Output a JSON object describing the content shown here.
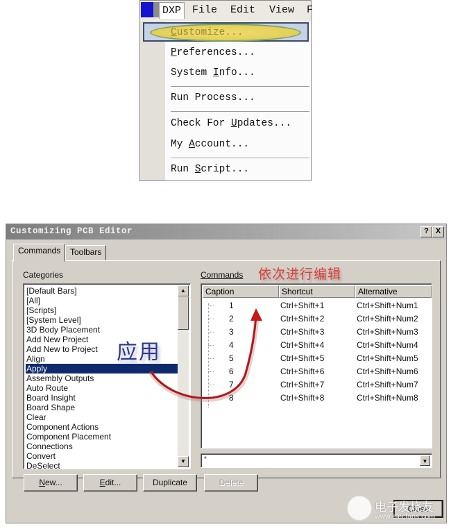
{
  "menu_screenshot": {
    "menubar": [
      "DXP",
      "File",
      "Edit",
      "View",
      "F"
    ],
    "items": [
      {
        "pre": "",
        "u": "C",
        "post": "ustomize...",
        "highlighted": true
      },
      {
        "pre": "",
        "u": "P",
        "post": "references..."
      },
      {
        "pre": "System ",
        "u": "I",
        "post": "nfo..."
      },
      {
        "pre": "Run Process...",
        "u": "",
        "post": ""
      },
      {
        "pre": "Check For ",
        "u": "U",
        "post": "pdates..."
      },
      {
        "pre": "My ",
        "u": "A",
        "post": "ccount..."
      },
      {
        "pre": "Run ",
        "u": "S",
        "post": "cript..."
      }
    ]
  },
  "dialog": {
    "title": "Customizing PCB Editor",
    "help_btn": "?",
    "close_btn": "X",
    "tabs": [
      "Commands",
      "Toolbars"
    ],
    "categories_label": "Categories",
    "commands_label": "Commands",
    "categories": [
      "[Default Bars]",
      "[All]",
      "[Scripts]",
      "[System Level]",
      "3D Body Placement",
      "Add New Project",
      "Add New to Project",
      "Align",
      "Apply",
      "Assembly Outputs",
      "Auto Route",
      "Board Insight",
      "Board Shape",
      "Clear",
      "Component Actions",
      "Component Placement",
      "Connections",
      "Convert",
      "DeSelect"
    ],
    "selected_category": "Apply",
    "columns": [
      "Caption",
      "Shortcut",
      "Alternative"
    ],
    "commands": [
      {
        "caption": "1",
        "shortcut": "Ctrl+Shift+1",
        "alternative": "Ctrl+Shift+Num1"
      },
      {
        "caption": "2",
        "shortcut": "Ctrl+Shift+2",
        "alternative": "Ctrl+Shift+Num2"
      },
      {
        "caption": "3",
        "shortcut": "Ctrl+Shift+3",
        "alternative": "Ctrl+Shift+Num3"
      },
      {
        "caption": "4",
        "shortcut": "Ctrl+Shift+4",
        "alternative": "Ctrl+Shift+Num4"
      },
      {
        "caption": "5",
        "shortcut": "Ctrl+Shift+5",
        "alternative": "Ctrl+Shift+Num5"
      },
      {
        "caption": "6",
        "shortcut": "Ctrl+Shift+6",
        "alternative": "Ctrl+Shift+Num6"
      },
      {
        "caption": "7",
        "shortcut": "Ctrl+Shift+7",
        "alternative": "Ctrl+Shift+Num7"
      },
      {
        "caption": "8",
        "shortcut": "Ctrl+Shift+8",
        "alternative": "Ctrl+Shift+Num8"
      }
    ],
    "filter_value": "*",
    "buttons": {
      "new": "New...",
      "edit": "Edit...",
      "duplicate": "Duplicate",
      "delete": "Delete",
      "close": "Close"
    }
  },
  "annotations": {
    "edit_in_order": "依次进行编辑",
    "apply": "应用",
    "arrow_color": "#b01818"
  },
  "watermark": {
    "name": "电子发烧友",
    "url": "www.elecfans.com"
  }
}
